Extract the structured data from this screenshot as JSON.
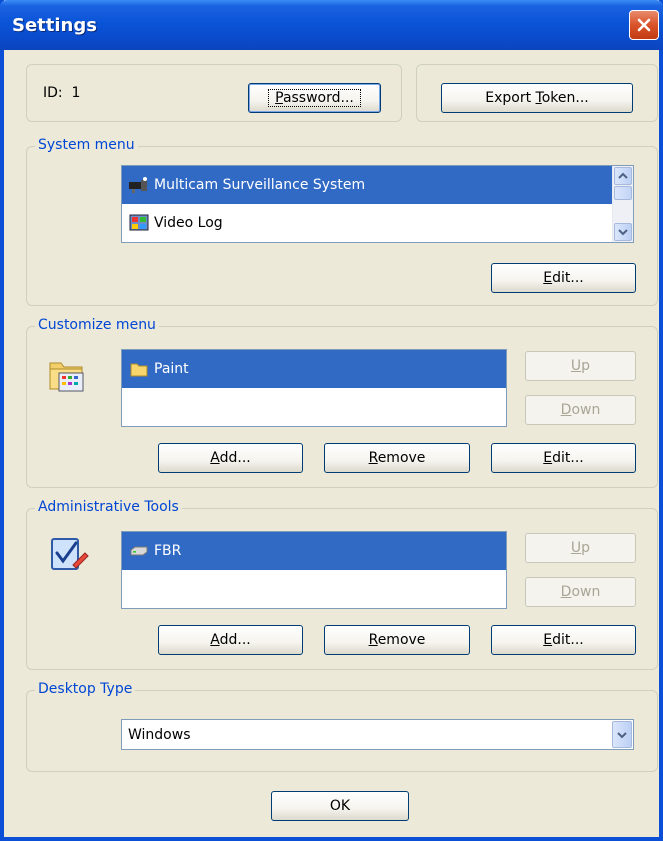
{
  "window": {
    "title": "Settings"
  },
  "id_row": {
    "id_label": "ID:",
    "id_value": "1",
    "password_button": {
      "pre": "",
      "ul": "P",
      "post": "assword..."
    },
    "export_button": {
      "pre": "Export ",
      "ul": "T",
      "post": "oken..."
    }
  },
  "system_menu": {
    "label": "System menu",
    "items": [
      {
        "label": "Multicam Surveillance System",
        "icon": "surveillance-icon",
        "selected": true
      },
      {
        "label": "Video Log",
        "icon": "video-log-icon",
        "selected": false
      }
    ],
    "edit_button": {
      "ul": "E",
      "post": "dit..."
    }
  },
  "customize_menu": {
    "label": "Customize menu",
    "items": [
      {
        "label": "Paint",
        "icon": "folder-icon",
        "selected": true
      }
    ],
    "up_button": {
      "ul": "U",
      "post": "p"
    },
    "down_button": {
      "ul": "D",
      "post": "own"
    },
    "add_button": {
      "ul": "A",
      "post": "dd..."
    },
    "remove_button": {
      "ul": "R",
      "post": "emove"
    },
    "edit_button": {
      "ul": "E",
      "post": "dit..."
    }
  },
  "admin_tools": {
    "label": "Administrative Tools",
    "items": [
      {
        "label": "FBR",
        "icon": "drive-icon",
        "selected": true
      }
    ],
    "up_button": {
      "ul": "U",
      "post": "p"
    },
    "down_button": {
      "ul": "D",
      "post": "own"
    },
    "add_button": {
      "ul": "A",
      "post": "dd..."
    },
    "remove_button": {
      "ul": "R",
      "post": "emove"
    },
    "edit_button": {
      "ul": "E",
      "post": "dit..."
    }
  },
  "desktop_type": {
    "label": "Desktop Type",
    "selected": "Windows"
  },
  "ok_button": "OK",
  "colors": {
    "title_bar": "#0a54d8",
    "selection": "#316ac5",
    "group_label": "#0046d5",
    "dialog_bg": "#ece9d8",
    "close_button": "#d9532a"
  }
}
